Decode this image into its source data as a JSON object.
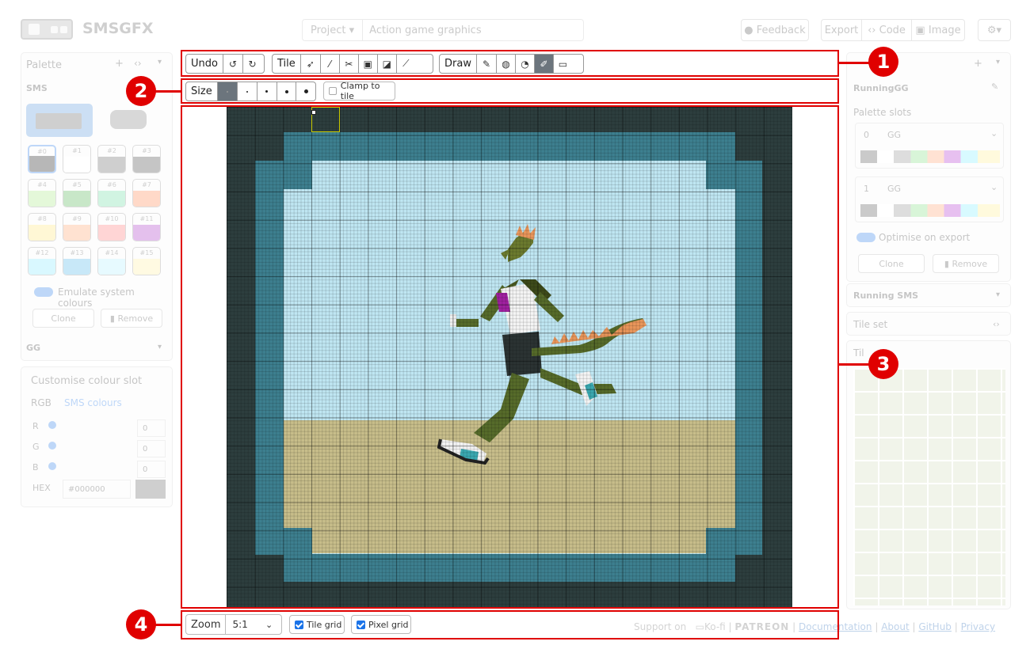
{
  "app": {
    "name": "SMSGFX"
  },
  "project": {
    "label": "Project",
    "value": "Action game graphics"
  },
  "header": {
    "feedback": "Feedback",
    "export": "Export",
    "code": "Code",
    "image": "Image"
  },
  "palette_panel": {
    "title": "Palette",
    "system_sms": "SMS",
    "slots": [
      "#0",
      "#1",
      "#2",
      "#3",
      "#4",
      "#5",
      "#6",
      "#7",
      "#8",
      "#9",
      "#10",
      "#11",
      "#12",
      "#13",
      "#14",
      "#15"
    ],
    "emulate": "Emulate system colours",
    "clone": "Clone",
    "remove": "Remove",
    "system_gg": "GG"
  },
  "colour_panel": {
    "title": "Customise colour slot",
    "tab_rgb": "RGB",
    "tab_sms": "SMS colours",
    "r_label": "R",
    "g_label": "G",
    "b_label": "B",
    "r_value": "0",
    "g_value": "0",
    "b_value": "0",
    "hex_label": "HEX",
    "hex_value": "#000000"
  },
  "right_panel": {
    "tile_name": "RunningGG",
    "palette_slots": "Palette slots",
    "slot0_num": "0",
    "slot0_name": "GG",
    "slot1_num": "1",
    "slot1_name": "GG",
    "optimise": "Optimise on export",
    "clone": "Clone",
    "remove": "Remove",
    "running_sms": "Running SMS",
    "tile_set": "Tile set",
    "tiles_header": "Til"
  },
  "toolbar": {
    "undo": "Undo",
    "tile": "Tile",
    "draw": "Draw",
    "size": "Size",
    "clamp": "Clamp to tile"
  },
  "bottom": {
    "zoom_label": "Zoom",
    "zoom_value": "5:1",
    "tile_grid": "Tile grid",
    "pixel_grid": "Pixel grid",
    "support": "Support on",
    "kofi": "Ko-fi",
    "patreon": "PATREON",
    "documentation": "Documentation",
    "about": "About",
    "github": "GitHub",
    "privacy": "Privacy"
  },
  "callouts": [
    "1",
    "2",
    "3",
    "4"
  ],
  "colors": {
    "callout": "#e00000",
    "sky": "#bfe6f2",
    "ground": "#c7bd8a",
    "border_teal": "#3d7f8f",
    "border_dark": "#2d3e3e"
  }
}
